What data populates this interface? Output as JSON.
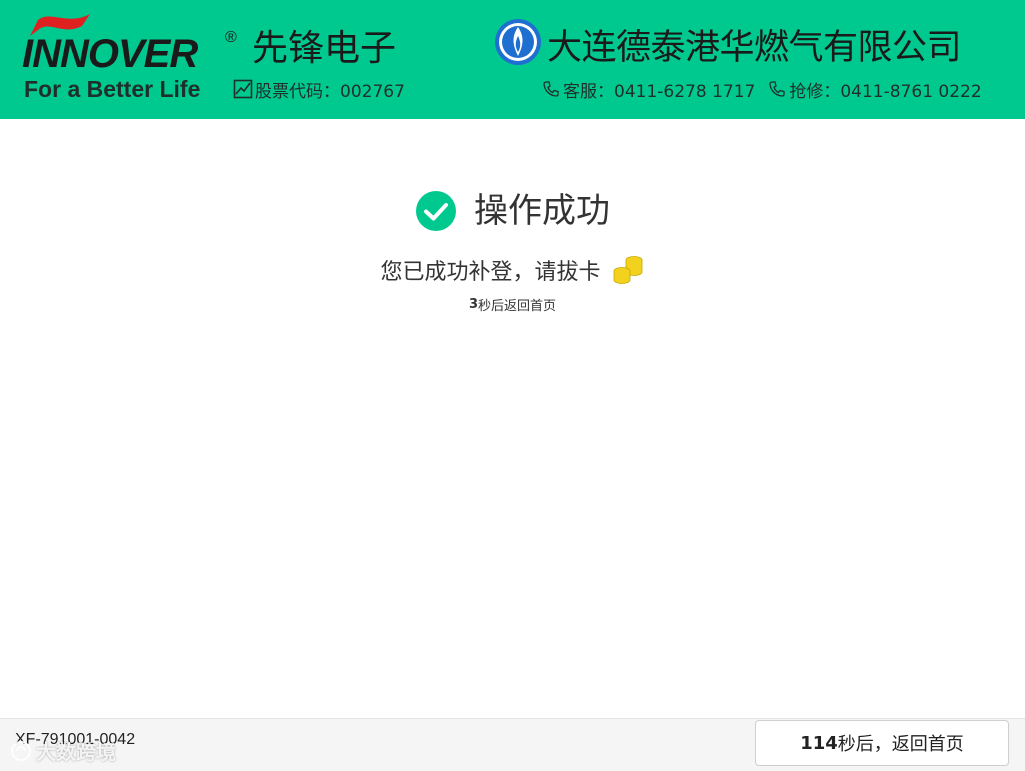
{
  "header": {
    "logo_text": "INNOVER",
    "logo_reg": "®",
    "brand_cn": "先锋电子",
    "slogan": "For a Better Life",
    "stock_label": "股票代码：002767",
    "gas_company": "大连德泰港华燃气有限公司",
    "service_label": "客服：0411-6278 1717",
    "repair_label": "抢修：0411-8761 0222"
  },
  "main": {
    "status_title": "操作成功",
    "message": "您已成功补登，请拔卡",
    "countdown_seconds": "3",
    "countdown_suffix": "秒后返回首页"
  },
  "footer": {
    "device_id": "XF-791001-0042",
    "return_seconds": "114",
    "return_suffix": "秒后，返回首页"
  },
  "watermark": {
    "text": "大数跨境"
  },
  "colors": {
    "header_bg": "#00c98f",
    "success_green": "#00c98f",
    "coin_yellow": "#f2d21c",
    "flag_red": "#e02020",
    "gas_blue": "#1f6fd1"
  },
  "icons": {
    "success": "check-circle-icon",
    "coins": "coins-icon",
    "stock": "chart-line-icon",
    "phone": "phone-icon"
  }
}
